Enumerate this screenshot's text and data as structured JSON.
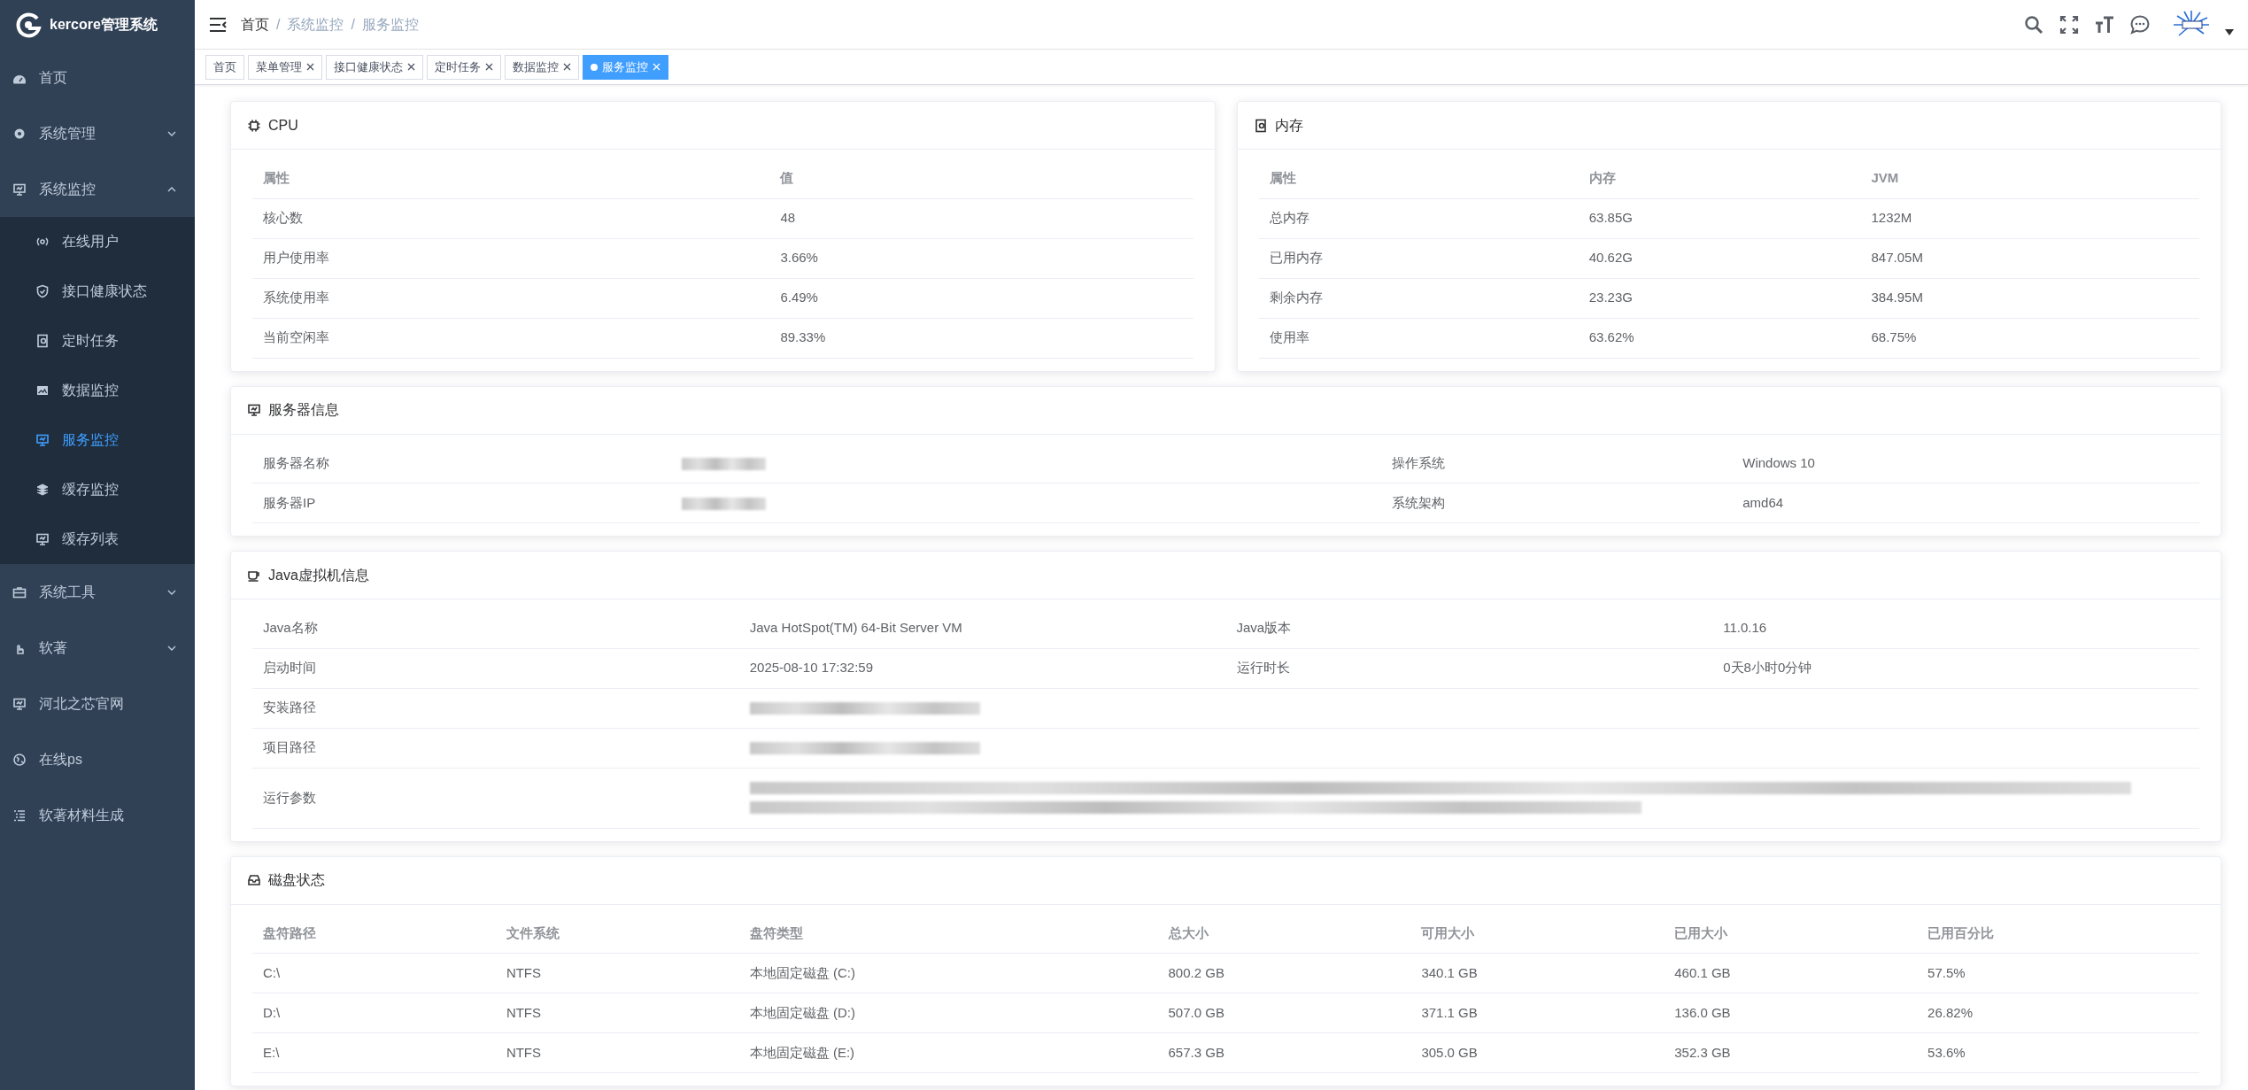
{
  "sidebar": {
    "brand": "kercore管理系统",
    "items": [
      {
        "label": "首页",
        "kind": "link",
        "expanded": false
      },
      {
        "label": "系统管理",
        "kind": "group",
        "expanded": false
      },
      {
        "label": "系统监控",
        "kind": "group",
        "expanded": true,
        "children": [
          {
            "label": "在线用户",
            "selected": false
          },
          {
            "label": "接口健康状态",
            "selected": false
          },
          {
            "label": "定时任务",
            "selected": false
          },
          {
            "label": "数据监控",
            "selected": false
          },
          {
            "label": "服务监控",
            "selected": true
          },
          {
            "label": "缓存监控",
            "selected": false
          },
          {
            "label": "缓存列表",
            "selected": false
          }
        ]
      },
      {
        "label": "系统工具",
        "kind": "group",
        "expanded": false
      },
      {
        "label": "软著",
        "kind": "group",
        "expanded": false
      },
      {
        "label": "河北之芯官网",
        "kind": "link",
        "expanded": false
      },
      {
        "label": "在线ps",
        "kind": "link",
        "expanded": false
      },
      {
        "label": "软著材料生成",
        "kind": "link",
        "expanded": false
      }
    ]
  },
  "breadcrumb": [
    "首页",
    "系统监控",
    "服务监控"
  ],
  "breadcrumb_separator": "/",
  "tabs": [
    {
      "label": "首页",
      "selected": false,
      "closable": false
    },
    {
      "label": "菜单管理",
      "selected": false,
      "closable": true
    },
    {
      "label": "接口健康状态",
      "selected": false,
      "closable": true
    },
    {
      "label": "定时任务",
      "selected": false,
      "closable": true
    },
    {
      "label": "数据监控",
      "selected": false,
      "closable": true
    },
    {
      "label": "服务监控",
      "selected": true,
      "closable": true
    }
  ],
  "cpu": {
    "title": "CPU",
    "columns": [
      "属性",
      "值"
    ],
    "rows": [
      [
        "核心数",
        "48"
      ],
      [
        "用户使用率",
        "3.66%"
      ],
      [
        "系统使用率",
        "6.49%"
      ],
      [
        "当前空闲率",
        "89.33%"
      ]
    ]
  },
  "memory": {
    "title": "内存",
    "columns": [
      "属性",
      "内存",
      "JVM"
    ],
    "rows": [
      [
        "总内存",
        "63.85G",
        "1232M"
      ],
      [
        "已用内存",
        "40.62G",
        "847.05M"
      ],
      [
        "剩余内存",
        "23.23G",
        "384.95M"
      ],
      [
        "使用率",
        "63.62%",
        "68.75%"
      ]
    ]
  },
  "server": {
    "title": "服务器信息",
    "rows": [
      [
        {
          "text": "服务器名称"
        },
        {
          "kind": "blurred"
        },
        {
          "text": "操作系统"
        },
        {
          "text": "Windows 10"
        }
      ],
      [
        {
          "text": "服务器IP"
        },
        {
          "kind": "blurred"
        },
        {
          "text": "系统架构"
        },
        {
          "text": "amd64"
        }
      ]
    ]
  },
  "jvm": {
    "title": "Java虚拟机信息",
    "rows": [
      [
        {
          "text": "Java名称"
        },
        {
          "text": "Java HotSpot(TM) 64-Bit Server VM"
        },
        {
          "text": "Java版本"
        },
        {
          "text": "11.0.16"
        }
      ],
      [
        {
          "text": "启动时间"
        },
        {
          "text": "2025-08-10 17:32:59"
        },
        {
          "text": "运行时长"
        },
        {
          "text": "0天8小时0分钟"
        }
      ],
      [
        {
          "text": "安装路径"
        },
        {
          "kind": "blurred"
        }
      ],
      [
        {
          "text": "项目路径"
        },
        {
          "kind": "blurred"
        }
      ],
      [
        {
          "text": "运行参数"
        },
        {
          "kind": "blurred-multiline"
        }
      ]
    ]
  },
  "disk": {
    "title": "磁盘状态",
    "columns": [
      "盘符路径",
      "文件系统",
      "盘符类型",
      "总大小",
      "可用大小",
      "已用大小",
      "已用百分比"
    ],
    "rows": [
      [
        "C:\\",
        "NTFS",
        "本地固定磁盘 (C:)",
        "800.2 GB",
        "340.1 GB",
        "460.1 GB",
        "57.5%"
      ],
      [
        "D:\\",
        "NTFS",
        "本地固定磁盘 (D:)",
        "507.0 GB",
        "371.1 GB",
        "136.0 GB",
        "26.82%"
      ],
      [
        "E:\\",
        "NTFS",
        "本地固定磁盘 (E:)",
        "657.3 GB",
        "305.0 GB",
        "352.3 GB",
        "53.6%"
      ]
    ]
  }
}
